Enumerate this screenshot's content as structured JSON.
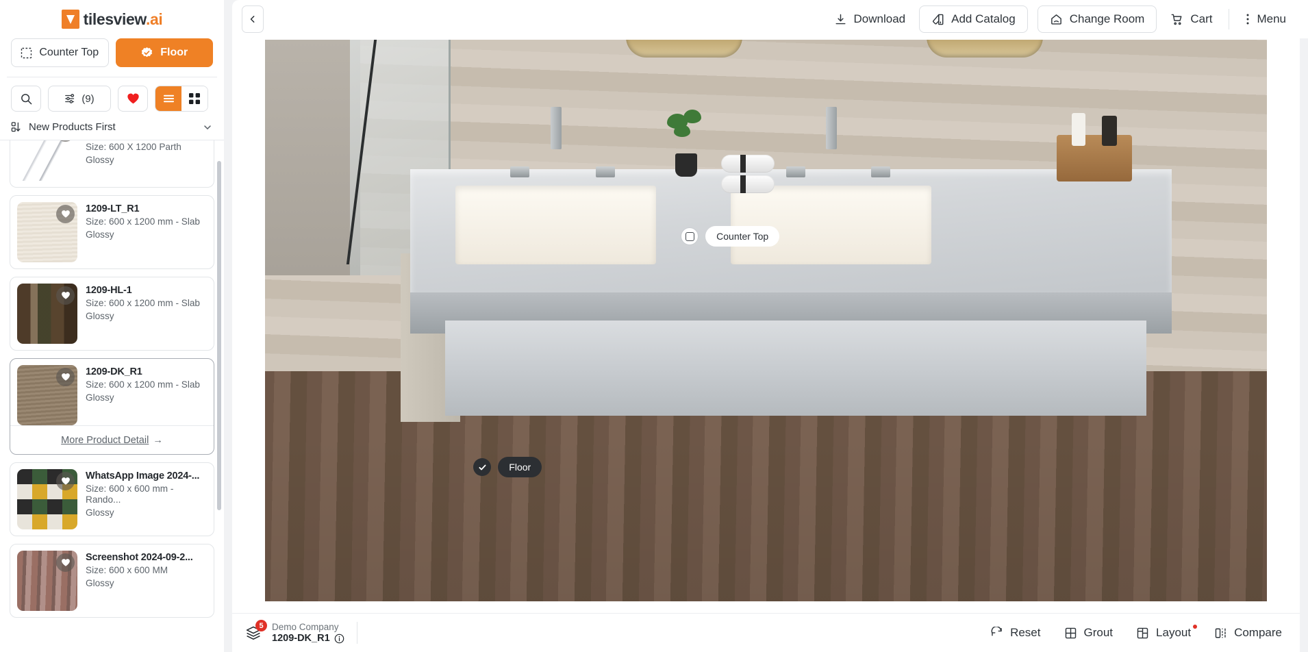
{
  "brand": {
    "name_main": "tilesview",
    "name_suffix": ".ai",
    "logo_icon": "tilesview-logo-icon"
  },
  "sidebar": {
    "surface_tabs": [
      {
        "label": "Counter Top",
        "icon": "dotted-square-icon",
        "active": false
      },
      {
        "label": "Floor",
        "icon": "check-badge-icon",
        "active": true
      }
    ],
    "tools": {
      "search_icon": "search-icon",
      "filter_icon": "sliders-icon",
      "filter_count": "(9)",
      "favorite_icon": "heart-icon",
      "list_view_icon": "list-view-icon",
      "grid_view_icon": "grid-view-icon"
    },
    "sort": {
      "label": "New Products First",
      "icon": "sort-icon",
      "chevron": "chevron-down-icon"
    },
    "products": [
      {
        "name": "",
        "size": "Size: 600 X 1200 Parth",
        "finish": "Glossy",
        "thumb_class": "tx-marble",
        "selected": false,
        "clipped": true
      },
      {
        "name": "1209-LT_R1",
        "size": "Size: 600 x 1200 mm - Slab",
        "finish": "Glossy",
        "thumb_class": "tx-lt",
        "selected": false
      },
      {
        "name": "1209-HL-1",
        "size": "Size: 600 x 1200 mm - Slab",
        "finish": "Glossy",
        "thumb_class": "tx-hl",
        "selected": false
      },
      {
        "name": "1209-DK_R1",
        "size": "Size: 600 x 1200 mm - Slab",
        "finish": "Glossy",
        "thumb_class": "tx-dk",
        "selected": true,
        "more_detail": "More Product Detail",
        "more_arrow": "→"
      },
      {
        "name": "WhatsApp Image 2024-...",
        "size": "Size: 600 x 600 mm - Rando...",
        "finish": "Glossy",
        "thumb_class": "tx-wa",
        "selected": false
      },
      {
        "name": "Screenshot 2024-09-2...",
        "size": "Size: 600 x 600 MM",
        "finish": "Glossy",
        "thumb_class": "tx-ss",
        "selected": false
      }
    ]
  },
  "topbar": {
    "back_icon": "chevron-left-icon",
    "actions": [
      {
        "label": "Download",
        "icon": "download-icon",
        "boxed": false
      },
      {
        "label": "Add Catalog",
        "icon": "catalog-icon",
        "boxed": true
      },
      {
        "label": "Change Room",
        "icon": "room-icon",
        "boxed": true
      },
      {
        "label": "Cart",
        "icon": "cart-icon",
        "boxed": false
      },
      {
        "label": "Menu",
        "icon": "kebab-menu-icon",
        "boxed": false
      }
    ]
  },
  "stage": {
    "tags": [
      {
        "label": "Counter Top",
        "style": "light",
        "icon": "checkbox-empty-icon"
      },
      {
        "label": "Floor",
        "style": "dark",
        "icon": "check-icon"
      }
    ]
  },
  "bottombar": {
    "layers_icon": "layers-icon",
    "badge_count": "5",
    "company": "Demo Company",
    "sku": "1209-DK_R1",
    "info_icon": "info-icon",
    "actions": [
      {
        "label": "Reset",
        "icon": "reset-icon",
        "dot": false
      },
      {
        "label": "Grout",
        "icon": "grout-grid-icon",
        "dot": false
      },
      {
        "label": "Layout",
        "icon": "layout-icon",
        "dot": true
      },
      {
        "label": "Compare",
        "icon": "compare-icon",
        "dot": false
      }
    ]
  },
  "colors": {
    "accent": "#ef8125",
    "danger": "#e03127",
    "text": "#2e343a",
    "muted": "#5d646b"
  }
}
